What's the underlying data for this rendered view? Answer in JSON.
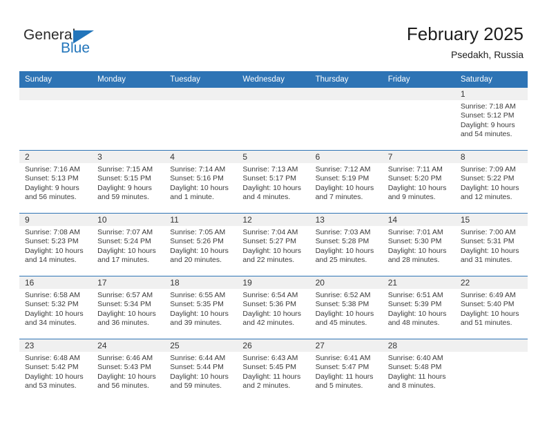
{
  "brand": {
    "name_top": "General",
    "name_bottom": "Blue",
    "triangle_color": "#2275bb",
    "text_color": "#2b2b2b"
  },
  "header": {
    "title": "February 2025",
    "subtitle": "Psedakh, Russia",
    "accent_color": "#2e74b5"
  },
  "weekday_headers": [
    "Sunday",
    "Monday",
    "Tuesday",
    "Wednesday",
    "Thursday",
    "Friday",
    "Saturday"
  ],
  "weeks": [
    [
      {
        "day": "",
        "sunrise": "",
        "sunset": "",
        "daylight_line1": "",
        "daylight_line2": ""
      },
      {
        "day": "",
        "sunrise": "",
        "sunset": "",
        "daylight_line1": "",
        "daylight_line2": ""
      },
      {
        "day": "",
        "sunrise": "",
        "sunset": "",
        "daylight_line1": "",
        "daylight_line2": ""
      },
      {
        "day": "",
        "sunrise": "",
        "sunset": "",
        "daylight_line1": "",
        "daylight_line2": ""
      },
      {
        "day": "",
        "sunrise": "",
        "sunset": "",
        "daylight_line1": "",
        "daylight_line2": ""
      },
      {
        "day": "",
        "sunrise": "",
        "sunset": "",
        "daylight_line1": "",
        "daylight_line2": ""
      },
      {
        "day": "1",
        "sunrise": "Sunrise: 7:18 AM",
        "sunset": "Sunset: 5:12 PM",
        "daylight_line1": "Daylight: 9 hours",
        "daylight_line2": "and 54 minutes."
      }
    ],
    [
      {
        "day": "2",
        "sunrise": "Sunrise: 7:16 AM",
        "sunset": "Sunset: 5:13 PM",
        "daylight_line1": "Daylight: 9 hours",
        "daylight_line2": "and 56 minutes."
      },
      {
        "day": "3",
        "sunrise": "Sunrise: 7:15 AM",
        "sunset": "Sunset: 5:15 PM",
        "daylight_line1": "Daylight: 9 hours",
        "daylight_line2": "and 59 minutes."
      },
      {
        "day": "4",
        "sunrise": "Sunrise: 7:14 AM",
        "sunset": "Sunset: 5:16 PM",
        "daylight_line1": "Daylight: 10 hours",
        "daylight_line2": "and 1 minute."
      },
      {
        "day": "5",
        "sunrise": "Sunrise: 7:13 AM",
        "sunset": "Sunset: 5:17 PM",
        "daylight_line1": "Daylight: 10 hours",
        "daylight_line2": "and 4 minutes."
      },
      {
        "day": "6",
        "sunrise": "Sunrise: 7:12 AM",
        "sunset": "Sunset: 5:19 PM",
        "daylight_line1": "Daylight: 10 hours",
        "daylight_line2": "and 7 minutes."
      },
      {
        "day": "7",
        "sunrise": "Sunrise: 7:11 AM",
        "sunset": "Sunset: 5:20 PM",
        "daylight_line1": "Daylight: 10 hours",
        "daylight_line2": "and 9 minutes."
      },
      {
        "day": "8",
        "sunrise": "Sunrise: 7:09 AM",
        "sunset": "Sunset: 5:22 PM",
        "daylight_line1": "Daylight: 10 hours",
        "daylight_line2": "and 12 minutes."
      }
    ],
    [
      {
        "day": "9",
        "sunrise": "Sunrise: 7:08 AM",
        "sunset": "Sunset: 5:23 PM",
        "daylight_line1": "Daylight: 10 hours",
        "daylight_line2": "and 14 minutes."
      },
      {
        "day": "10",
        "sunrise": "Sunrise: 7:07 AM",
        "sunset": "Sunset: 5:24 PM",
        "daylight_line1": "Daylight: 10 hours",
        "daylight_line2": "and 17 minutes."
      },
      {
        "day": "11",
        "sunrise": "Sunrise: 7:05 AM",
        "sunset": "Sunset: 5:26 PM",
        "daylight_line1": "Daylight: 10 hours",
        "daylight_line2": "and 20 minutes."
      },
      {
        "day": "12",
        "sunrise": "Sunrise: 7:04 AM",
        "sunset": "Sunset: 5:27 PM",
        "daylight_line1": "Daylight: 10 hours",
        "daylight_line2": "and 22 minutes."
      },
      {
        "day": "13",
        "sunrise": "Sunrise: 7:03 AM",
        "sunset": "Sunset: 5:28 PM",
        "daylight_line1": "Daylight: 10 hours",
        "daylight_line2": "and 25 minutes."
      },
      {
        "day": "14",
        "sunrise": "Sunrise: 7:01 AM",
        "sunset": "Sunset: 5:30 PM",
        "daylight_line1": "Daylight: 10 hours",
        "daylight_line2": "and 28 minutes."
      },
      {
        "day": "15",
        "sunrise": "Sunrise: 7:00 AM",
        "sunset": "Sunset: 5:31 PM",
        "daylight_line1": "Daylight: 10 hours",
        "daylight_line2": "and 31 minutes."
      }
    ],
    [
      {
        "day": "16",
        "sunrise": "Sunrise: 6:58 AM",
        "sunset": "Sunset: 5:32 PM",
        "daylight_line1": "Daylight: 10 hours",
        "daylight_line2": "and 34 minutes."
      },
      {
        "day": "17",
        "sunrise": "Sunrise: 6:57 AM",
        "sunset": "Sunset: 5:34 PM",
        "daylight_line1": "Daylight: 10 hours",
        "daylight_line2": "and 36 minutes."
      },
      {
        "day": "18",
        "sunrise": "Sunrise: 6:55 AM",
        "sunset": "Sunset: 5:35 PM",
        "daylight_line1": "Daylight: 10 hours",
        "daylight_line2": "and 39 minutes."
      },
      {
        "day": "19",
        "sunrise": "Sunrise: 6:54 AM",
        "sunset": "Sunset: 5:36 PM",
        "daylight_line1": "Daylight: 10 hours",
        "daylight_line2": "and 42 minutes."
      },
      {
        "day": "20",
        "sunrise": "Sunrise: 6:52 AM",
        "sunset": "Sunset: 5:38 PM",
        "daylight_line1": "Daylight: 10 hours",
        "daylight_line2": "and 45 minutes."
      },
      {
        "day": "21",
        "sunrise": "Sunrise: 6:51 AM",
        "sunset": "Sunset: 5:39 PM",
        "daylight_line1": "Daylight: 10 hours",
        "daylight_line2": "and 48 minutes."
      },
      {
        "day": "22",
        "sunrise": "Sunrise: 6:49 AM",
        "sunset": "Sunset: 5:40 PM",
        "daylight_line1": "Daylight: 10 hours",
        "daylight_line2": "and 51 minutes."
      }
    ],
    [
      {
        "day": "23",
        "sunrise": "Sunrise: 6:48 AM",
        "sunset": "Sunset: 5:42 PM",
        "daylight_line1": "Daylight: 10 hours",
        "daylight_line2": "and 53 minutes."
      },
      {
        "day": "24",
        "sunrise": "Sunrise: 6:46 AM",
        "sunset": "Sunset: 5:43 PM",
        "daylight_line1": "Daylight: 10 hours",
        "daylight_line2": "and 56 minutes."
      },
      {
        "day": "25",
        "sunrise": "Sunrise: 6:44 AM",
        "sunset": "Sunset: 5:44 PM",
        "daylight_line1": "Daylight: 10 hours",
        "daylight_line2": "and 59 minutes."
      },
      {
        "day": "26",
        "sunrise": "Sunrise: 6:43 AM",
        "sunset": "Sunset: 5:45 PM",
        "daylight_line1": "Daylight: 11 hours",
        "daylight_line2": "and 2 minutes."
      },
      {
        "day": "27",
        "sunrise": "Sunrise: 6:41 AM",
        "sunset": "Sunset: 5:47 PM",
        "daylight_line1": "Daylight: 11 hours",
        "daylight_line2": "and 5 minutes."
      },
      {
        "day": "28",
        "sunrise": "Sunrise: 6:40 AM",
        "sunset": "Sunset: 5:48 PM",
        "daylight_line1": "Daylight: 11 hours",
        "daylight_line2": "and 8 minutes."
      },
      {
        "day": "",
        "sunrise": "",
        "sunset": "",
        "daylight_line1": "",
        "daylight_line2": ""
      }
    ]
  ]
}
